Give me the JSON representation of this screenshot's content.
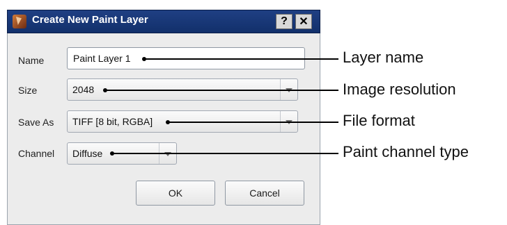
{
  "dialog": {
    "title": "Create New Paint Layer",
    "help_label": "?",
    "close_label": "✕",
    "labels": {
      "name": "Name",
      "size": "Size",
      "save_as": "Save As",
      "channel": "Channel"
    },
    "fields": {
      "name_value": "Paint Layer 1",
      "size_value": "2048",
      "save_as_value": "TIFF [8 bit, RGBA]",
      "channel_value": "Diffuse"
    },
    "buttons": {
      "ok": "OK",
      "cancel": "Cancel"
    }
  },
  "callouts": {
    "layer_name": "Layer name",
    "image_resolution": "Image resolution",
    "file_format": "File format",
    "paint_channel_type": "Paint channel type"
  }
}
